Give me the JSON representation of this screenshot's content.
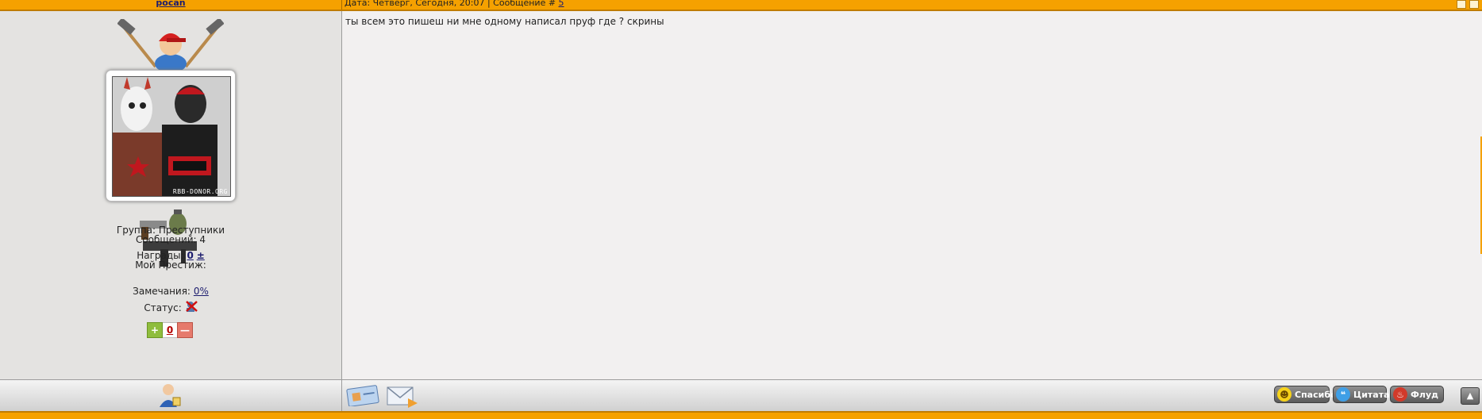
{
  "post": {
    "username": "pocan",
    "meta_text": "Дата: Четверг, Сегодня, 20:07 | Сообщение #",
    "post_number": "5",
    "message": "ты всем это пишеш ни мне одному написал пруф где ? скрины"
  },
  "avatar": {
    "watermark": "RBB-DONOR.ORG"
  },
  "user_info": {
    "group": "Группа: Преступники",
    "posts": "Сообщений: 4",
    "awards_label": "Награды:",
    "awards_value": "0",
    "awards_plus": "±",
    "prestige_label": "Мой Престиж:",
    "rep_plus": "+",
    "rep_value": "0",
    "rep_minus": "—",
    "warnings_label": "Замечания:",
    "warnings_value": "0%",
    "status_label": "Статус:"
  },
  "buttons": {
    "thanks": "Спасибо",
    "quote": "Цитата",
    "flood": "Флуд"
  },
  "icons": {
    "rank": "hammers-user-icon",
    "weapons": "weapons-icon",
    "status": "offline-status-icon",
    "profile": "user-profile-icon",
    "card": "business-card-icon",
    "mail": "mail-icon",
    "up": "scroll-up-icon"
  },
  "colors": {
    "accent": "#f5a100",
    "link": "#1c1c6e"
  }
}
